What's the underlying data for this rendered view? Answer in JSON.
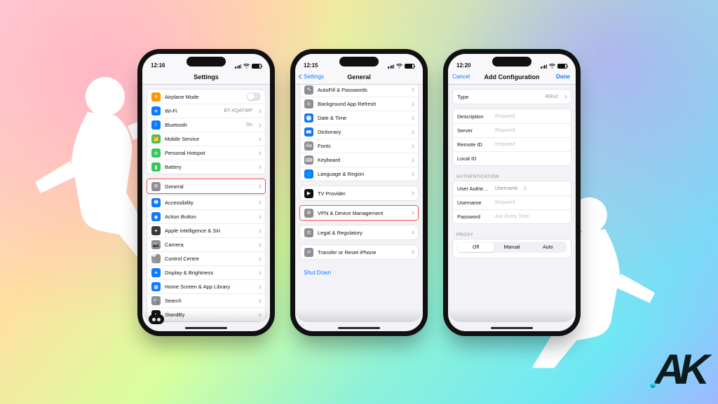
{
  "decor": {
    "logo": "AK"
  },
  "phone1": {
    "time": "12:16",
    "title": "Settings",
    "group1": [
      {
        "icon": "airplane-icon",
        "bg": "bg-orange",
        "label": "Airplane Mode",
        "toggle": true
      },
      {
        "icon": "wifi-icon",
        "bg": "bg-blue",
        "label": "Wi-Fi",
        "value": "BT-XQATWP"
      },
      {
        "icon": "bluetooth-icon",
        "bg": "bg-blue",
        "label": "Bluetooth",
        "value": "On"
      },
      {
        "icon": "antenna-icon",
        "bg": "bg-green",
        "label": "Mobile Service"
      },
      {
        "icon": "hotspot-icon",
        "bg": "bg-green",
        "label": "Personal Hotspot"
      },
      {
        "icon": "battery-icon",
        "bg": "bg-green",
        "label": "Battery"
      }
    ],
    "group2_hl": [
      {
        "icon": "gear-icon",
        "bg": "bg-gray",
        "label": "General"
      }
    ],
    "group2_rest": [
      {
        "icon": "accessibility-icon",
        "bg": "bg-blue",
        "label": "Accessibility"
      },
      {
        "icon": "action-icon",
        "bg": "bg-blue",
        "label": "Action Button"
      },
      {
        "icon": "siri-icon",
        "bg": "bg-dark",
        "label": "Apple Intelligence & Siri"
      },
      {
        "icon": "camera-icon",
        "bg": "bg-gray",
        "label": "Camera"
      },
      {
        "icon": "control-icon",
        "bg": "bg-gray",
        "label": "Control Centre"
      },
      {
        "icon": "brightness-icon",
        "bg": "bg-blue",
        "label": "Display & Brightness"
      },
      {
        "icon": "homescreen-icon",
        "bg": "bg-blue",
        "label": "Home Screen & App Library"
      },
      {
        "icon": "search-icon",
        "bg": "bg-gray",
        "label": "Search"
      },
      {
        "icon": "standby-icon",
        "bg": "bg-black",
        "label": "StandBy"
      }
    ]
  },
  "phone2": {
    "time": "12:15",
    "back": "Settings",
    "title": "General",
    "top_cut": [
      {
        "icon": "autofill-icon",
        "bg": "bg-gray",
        "label": "AutoFill & Passwords"
      },
      {
        "icon": "refresh-icon",
        "bg": "bg-gray",
        "label": "Background App Refresh"
      },
      {
        "icon": "clock-icon",
        "bg": "bg-blue",
        "label": "Date & Time"
      },
      {
        "icon": "dictionary-icon",
        "bg": "bg-blue",
        "label": "Dictionary"
      },
      {
        "icon": "fonts-icon",
        "bg": "bg-gray",
        "label": "Fonts"
      },
      {
        "icon": "keyboard-icon",
        "bg": "bg-gray",
        "label": "Keyboard"
      },
      {
        "icon": "globe-icon",
        "bg": "bg-blue",
        "label": "Language & Region"
      }
    ],
    "tv": [
      {
        "icon": "tv-icon",
        "bg": "bg-black",
        "label": "TV Provider"
      }
    ],
    "vpn_hl": [
      {
        "icon": "vpn-icon",
        "bg": "bg-gray",
        "label": "VPN & Device Management"
      }
    ],
    "legal": [
      {
        "icon": "legal-icon",
        "bg": "bg-gray",
        "label": "Legal & Regulatory"
      }
    ],
    "transfer": [
      {
        "icon": "transfer-icon",
        "bg": "bg-gray",
        "label": "Transfer or Reset iPhone"
      }
    ],
    "shutdown": "Shut Down"
  },
  "phone3": {
    "time": "12:20",
    "cancel": "Cancel",
    "title": "Add Configuration",
    "done": "Done",
    "type_row": {
      "label": "Type",
      "value": "IKEv2"
    },
    "fields": [
      {
        "label": "Description",
        "placeholder": "Required"
      },
      {
        "label": "Server",
        "placeholder": "Required"
      },
      {
        "label": "Remote ID",
        "placeholder": "Required"
      },
      {
        "label": "Local ID",
        "placeholder": ""
      }
    ],
    "auth_header": "AUTHENTICATION",
    "auth": [
      {
        "label": "User Authentication",
        "value": "Username",
        "chevron": true
      },
      {
        "label": "Username",
        "placeholder": "Required"
      },
      {
        "label": "Password",
        "placeholder": "Ask Every Time"
      }
    ],
    "proxy_header": "PROXY",
    "proxy": {
      "options": [
        "Off",
        "Manual",
        "Auto"
      ],
      "selected": 0
    }
  }
}
